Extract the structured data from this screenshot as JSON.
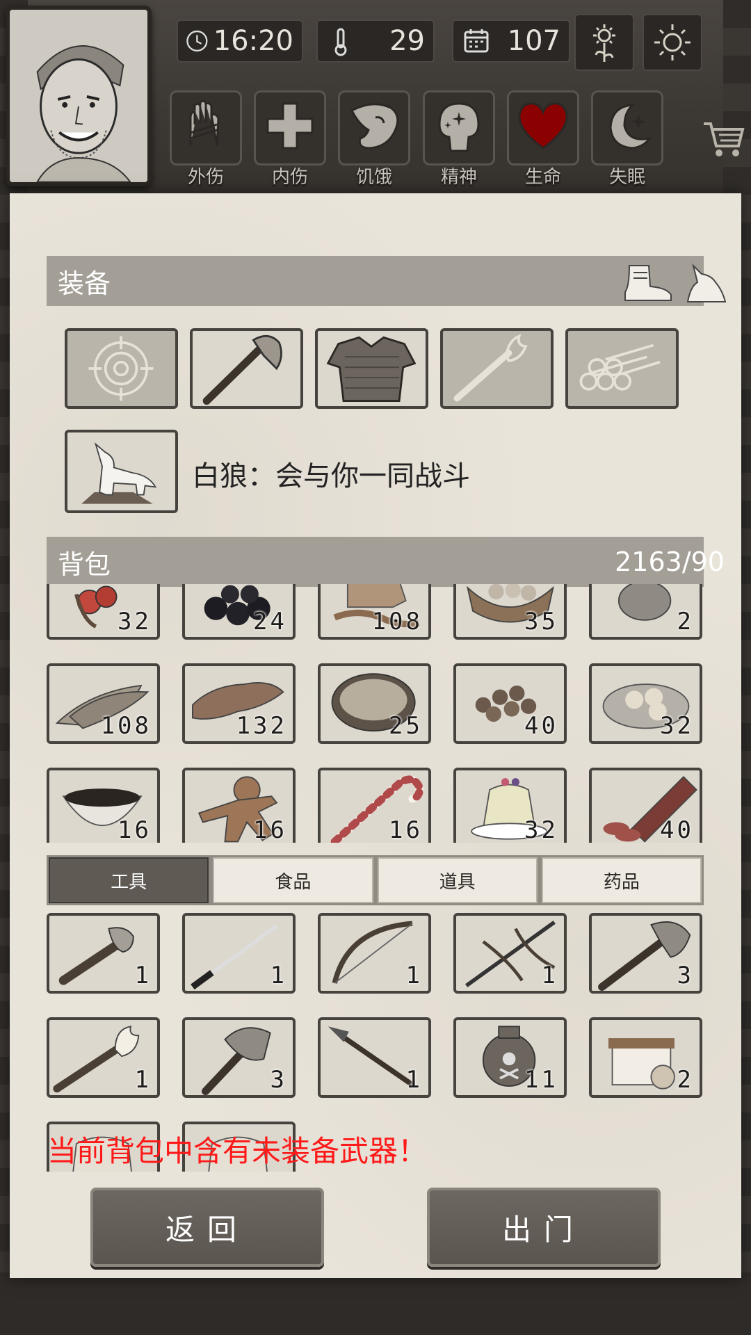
{
  "header": {
    "time": "16:20",
    "temperature": "29",
    "day": "107"
  },
  "status_icons": [
    {
      "label": "外伤",
      "icon": "bandaged-hand-icon"
    },
    {
      "label": "内伤",
      "icon": "cross-icon"
    },
    {
      "label": "饥饿",
      "icon": "stomach-icon"
    },
    {
      "label": "精神",
      "icon": "head-sparkle-icon"
    },
    {
      "label": "生命",
      "icon": "heart-icon"
    },
    {
      "label": "失眠",
      "icon": "moon-star-icon"
    }
  ],
  "equipment": {
    "title": "装备",
    "slots": [
      {
        "icon": "target-icon",
        "empty": true
      },
      {
        "icon": "axe-icon",
        "empty": false
      },
      {
        "icon": "armor-icon",
        "empty": false
      },
      {
        "icon": "torch-icon",
        "empty": true
      },
      {
        "icon": "logs-icon",
        "empty": true
      }
    ],
    "pet": {
      "icon": "white-wolf-icon",
      "text": "白狼：会与你一同战斗"
    }
  },
  "backpack": {
    "title": "背包",
    "capacity": "2163/90",
    "rows": [
      [
        {
          "icon": "berries-icon",
          "count": "32"
        },
        {
          "icon": "blackberries-icon",
          "count": "24"
        },
        {
          "icon": "honeycomb-icon",
          "count": "108"
        },
        {
          "icon": "basket-icon",
          "count": "35"
        },
        {
          "icon": "egg-icon",
          "count": "2"
        }
      ],
      [
        {
          "icon": "dried-fish-icon",
          "count": "108"
        },
        {
          "icon": "bacon-icon",
          "count": "132"
        },
        {
          "icon": "stew-bowl-icon",
          "count": "25"
        },
        {
          "icon": "meatballs-icon",
          "count": "40"
        },
        {
          "icon": "dumplings-plate-icon",
          "count": "32"
        }
      ],
      [
        {
          "icon": "bowl-icon",
          "count": "16"
        },
        {
          "icon": "gingerbread-icon",
          "count": "16"
        },
        {
          "icon": "candy-cane-icon",
          "count": "16"
        },
        {
          "icon": "pudding-icon",
          "count": "32"
        },
        {
          "icon": "sausage-icon",
          "count": "40"
        }
      ]
    ]
  },
  "tabs": [
    {
      "label": "工具",
      "active": true
    },
    {
      "label": "食品",
      "active": false
    },
    {
      "label": "道具",
      "active": false
    },
    {
      "label": "药品",
      "active": false
    }
  ],
  "tools": {
    "rows": [
      [
        {
          "icon": "stone-axe-icon",
          "count": "1"
        },
        {
          "icon": "katana-icon",
          "count": "1"
        },
        {
          "icon": "bow-icon",
          "count": "1"
        },
        {
          "icon": "crossbow-icon",
          "count": "1"
        },
        {
          "icon": "hatchet-icon",
          "count": "3"
        }
      ],
      [
        {
          "icon": "fire-staff-icon",
          "count": "1"
        },
        {
          "icon": "war-axe-icon",
          "count": "3"
        },
        {
          "icon": "spear-icon",
          "count": "1"
        },
        {
          "icon": "poison-jar-icon",
          "count": "11"
        },
        {
          "icon": "gift-box-icon",
          "count": "2"
        }
      ],
      [
        {
          "icon": "bag-icon",
          "count": ""
        },
        {
          "icon": "bag-icon",
          "count": ""
        }
      ]
    ]
  },
  "warning": "当前背包中含有未装备武器！",
  "buttons": {
    "back": "返回",
    "go_out": "出门"
  },
  "colors": {
    "warning": "#ff1a1a",
    "heart": "#8b0000",
    "paper": "#e9e4da"
  }
}
